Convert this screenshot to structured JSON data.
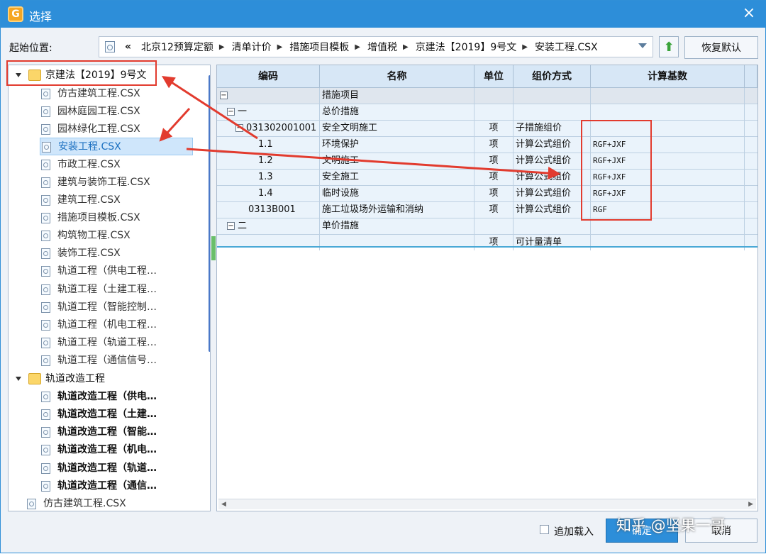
{
  "window": {
    "title": "选择",
    "close_icon": "close-icon",
    "app_icon": "app-logo-icon"
  },
  "location": {
    "label": "起始位置:",
    "back": "«",
    "crumbs": [
      "北京12预算定额",
      "清单计价",
      "措施项目模板",
      "增值税",
      "京建法【2019】9号文",
      "安装工程.CSX"
    ],
    "restore_label": "恢复默认"
  },
  "tree": {
    "root": "京建法【2019】9号文",
    "children": [
      "仿古建筑工程.CSX",
      "园林庭园工程.CSX",
      "园林绿化工程.CSX",
      "安装工程.CSX",
      "市政工程.CSX",
      "建筑与装饰工程.CSX",
      "建筑工程.CSX",
      "措施项目模板.CSX",
      "构筑物工程.CSX",
      "装饰工程.CSX",
      "轨道工程（供电工程…",
      "轨道工程（土建工程…",
      "轨道工程（智能控制…",
      "轨道工程（机电工程…",
      "轨道工程（轨道工程…",
      "轨道工程（通信信号…"
    ],
    "folder2": "轨道改造工程",
    "folder2_children": [
      "轨道改造工程（供电…",
      "轨道改造工程（土建…",
      "轨道改造工程（智能…",
      "轨道改造工程（机电…",
      "轨道改造工程（轨道…",
      "轨道改造工程（通信…"
    ],
    "last": "仿古建筑工程.CSX"
  },
  "grid": {
    "headers": [
      "编码",
      "名称",
      "单位",
      "组价方式",
      "计算基数"
    ],
    "rows": [
      {
        "code": "",
        "name": "措施项目",
        "unit": "",
        "method": "",
        "base": "",
        "expander": "−"
      },
      {
        "code": "一",
        "name": "总价措施",
        "unit": "",
        "method": "",
        "base": "",
        "expander": "−"
      },
      {
        "code": "031302001001",
        "name": "安全文明施工",
        "unit": "项",
        "method": "子措施组价",
        "base": "",
        "expander": "−"
      },
      {
        "code": "1.1",
        "name": "环境保护",
        "unit": "项",
        "method": "计算公式组价",
        "base": "RGF+JXF"
      },
      {
        "code": "1.2",
        "name": "文明施工",
        "unit": "项",
        "method": "计算公式组价",
        "base": "RGF+JXF"
      },
      {
        "code": "1.3",
        "name": "安全施工",
        "unit": "项",
        "method": "计算公式组价",
        "base": "RGF+JXF"
      },
      {
        "code": "1.4",
        "name": "临时设施",
        "unit": "项",
        "method": "计算公式组价",
        "base": "RGF+JXF"
      },
      {
        "code": "0313B001",
        "name": "施工垃圾场外运输和消纳",
        "unit": "项",
        "method": "计算公式组价",
        "base": "RGF"
      },
      {
        "code": "二",
        "name": "单价措施",
        "unit": "",
        "method": "",
        "base": "",
        "expander": "−"
      },
      {
        "code": "",
        "name": "",
        "unit": "项",
        "method": "可计量清单",
        "base": ""
      }
    ]
  },
  "footer": {
    "append_label": "追加载入",
    "ok_label": "确定",
    "cancel_label": "取消",
    "watermark": "知乎 @坚果一哥"
  }
}
